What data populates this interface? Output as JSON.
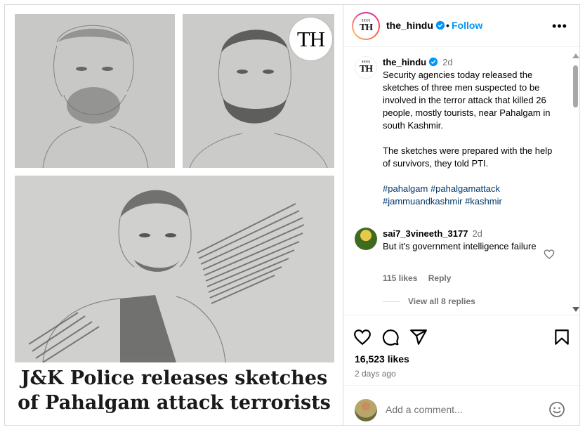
{
  "media": {
    "badge": "TH",
    "headline_line1": "J&K Police releases sketches",
    "headline_line2": "of Pahalgam attack terrorists"
  },
  "header": {
    "username": "the_hindu",
    "separator": "•",
    "follow_label": "Follow",
    "more_label": "•••"
  },
  "caption": {
    "username": "the_hindu",
    "time": "2d",
    "paragraph1": "Security agencies today released the sketches of three men suspected to be involved in the terror attack that killed 26 people, mostly tourists, near Pahalgam in south Kashmir.",
    "paragraph2": "The sketches were prepared with the help of survivors, they told PTI.",
    "hashtags": [
      "#pahalgam",
      "#pahalgamattack",
      "#jammuandkashmir",
      "#kashmir"
    ]
  },
  "comment": {
    "username": "sai7_3vineeth_3177",
    "time": "2d",
    "text": "But it's government intelligence failure",
    "likes": "115 likes",
    "reply_label": "Reply",
    "view_replies": "View all 8 replies"
  },
  "actions": {
    "likes": "16,523 likes",
    "ago": "2 days ago"
  },
  "add_comment": {
    "placeholder": "Add a comment..."
  },
  "colors": {
    "accent": "#0095f6",
    "hashtag": "#00376b",
    "muted": "#737373",
    "verified": "#0095f6"
  },
  "icons": [
    "verified-icon",
    "more-icon",
    "heart-icon",
    "comment-icon",
    "share-icon",
    "bookmark-icon",
    "emoji-icon"
  ]
}
